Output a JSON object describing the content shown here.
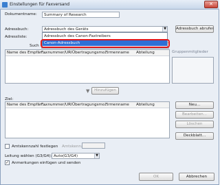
{
  "window": {
    "title": "Einstellungen für Faxversand",
    "close_glyph": "✕"
  },
  "document_name": {
    "label": "Dokumentname:",
    "value": "Summary of Research"
  },
  "addressbook": {
    "label": "Adressbuch:",
    "selected": "Adressbuch des Geräts",
    "open_button": "Adressbuch abrufen",
    "options": [
      "Adressbuch des Canon-Faxtreibers",
      "Canon-Adressbuch"
    ],
    "highlighted_option": "Canon-Adressbuch"
  },
  "addresslist": {
    "label": "Adressliste:",
    "search_label": "Such",
    "group_members_label": "Gruppenmitglieder",
    "columns": [
      "Name des Empfän...",
      "Faxnummer/URI",
      "Übertragungsmo...",
      "Firmenname",
      "Abteilung"
    ]
  },
  "add_button": "Hinzufügen",
  "destination": {
    "label": "Ziel:",
    "columns": [
      "Name des Empfän...",
      "Faxnummer/URI",
      "Übertragungsmo...",
      "Firmenname",
      "Abteilung"
    ],
    "buttons": {
      "new": "Neu...",
      "edit": "Bearbeiten...",
      "delete": "Löschen",
      "cover_sheet": "Deckblatt..."
    }
  },
  "outside_dialing": {
    "checkbox_label": "Amtskennzahl festlegen",
    "number_label": "Amtskennzahl:",
    "checked": false
  },
  "line_selection": {
    "label": "Leitung wählen (G3/G4):",
    "value": "Auto(G3/G4)"
  },
  "send_with_notes": {
    "label": "Anmerkungen einfügen und senden",
    "checked": true
  },
  "footer": {
    "ok": "OK",
    "cancel": "Abbrechen"
  },
  "colors": {
    "accent": "#2f6fd6",
    "callout": "#e0181d"
  }
}
